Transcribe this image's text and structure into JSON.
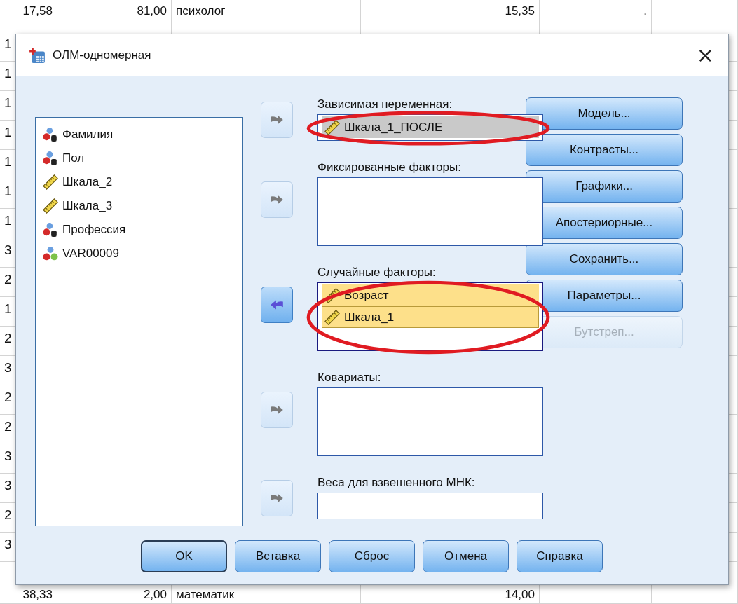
{
  "sheet": {
    "rows": [
      {
        "kind": "full",
        "cells": [
          "17,58",
          "81,00",
          "психолог",
          "15,35",
          "."
        ]
      },
      {
        "kind": "cut",
        "cells": [
          "1"
        ]
      },
      {
        "kind": "cut",
        "cells": [
          "1"
        ]
      },
      {
        "kind": "cut",
        "cells": [
          "1"
        ]
      },
      {
        "kind": "cut",
        "cells": [
          "1"
        ]
      },
      {
        "kind": "cut",
        "cells": [
          "1"
        ]
      },
      {
        "kind": "cut",
        "cells": [
          "1"
        ]
      },
      {
        "kind": "cut",
        "cells": [
          "1"
        ]
      },
      {
        "kind": "cut",
        "cells": [
          "3"
        ]
      },
      {
        "kind": "cut",
        "cells": [
          "2"
        ]
      },
      {
        "kind": "cut",
        "cells": [
          "1"
        ]
      },
      {
        "kind": "cut",
        "cells": [
          "2"
        ]
      },
      {
        "kind": "cut",
        "cells": [
          "3"
        ]
      },
      {
        "kind": "cut",
        "cells": [
          "2"
        ]
      },
      {
        "kind": "cut",
        "cells": [
          "2"
        ]
      },
      {
        "kind": "cut",
        "cells": [
          "3"
        ]
      },
      {
        "kind": "cut",
        "cells": [
          "3"
        ]
      },
      {
        "kind": "cut",
        "cells": [
          "2"
        ]
      },
      {
        "kind": "cut",
        "cells": [
          "3"
        ]
      },
      {
        "kind": "last",
        "cells": [
          "38,33",
          "2,00",
          "математик",
          "14,00"
        ]
      }
    ]
  },
  "dialog": {
    "title": "ОЛМ-одномерная",
    "close": "×",
    "variables": [
      {
        "name": "Фамилия",
        "kind": "nominal-string",
        "selected": false
      },
      {
        "name": "Пол",
        "kind": "nominal-string",
        "selected": false
      },
      {
        "name": "Шкала_2",
        "kind": "scale",
        "selected": false
      },
      {
        "name": "Шкала_3",
        "kind": "scale",
        "selected": false
      },
      {
        "name": "Профессия",
        "kind": "nominal-string",
        "selected": false
      },
      {
        "name": "VAR00009",
        "kind": "nominal",
        "selected": false
      }
    ],
    "targets": [
      {
        "label": "Зависимая переменная:",
        "kind": "single",
        "active": false,
        "circled": true,
        "arrow": {
          "kind": "right",
          "highlighted": false
        },
        "items": [
          {
            "name": "Шкала_1_ПОСЛЕ",
            "kind": "scale",
            "selected": true,
            "focused": false
          }
        ]
      },
      {
        "label": "Фиксированные факторы:",
        "kind": "list",
        "active": false,
        "circled": false,
        "arrow": {
          "kind": "right",
          "highlighted": false
        }
      },
      {
        "label": "Случайные факторы:",
        "kind": "list",
        "active": true,
        "circled": true,
        "arrow": {
          "kind": "left",
          "highlighted": true
        },
        "items": [
          {
            "name": "Возраст",
            "kind": "scale",
            "selected": true,
            "focused": false
          },
          {
            "name": "Шкала_1",
            "kind": "scale",
            "selected": true,
            "focused": true
          }
        ]
      },
      {
        "label": "Ковариаты:",
        "kind": "list",
        "active": false,
        "circled": false,
        "arrow": {
          "kind": "right",
          "highlighted": false
        }
      },
      {
        "label": "Веса для взвешенного МНК:",
        "kind": "single",
        "active": false,
        "circled": false,
        "arrow": {
          "kind": "right",
          "highlighted": false
        }
      }
    ],
    "side_buttons": [
      {
        "label": "Модель...",
        "disabled": false
      },
      {
        "label": "Контрасты...",
        "disabled": false
      },
      {
        "label": "Графики...",
        "disabled": false
      },
      {
        "label": "Апостериорные...",
        "disabled": false
      },
      {
        "label": "Сохранить...",
        "disabled": false
      },
      {
        "label": "Параметры...",
        "disabled": false
      },
      {
        "label": "Бутстреп...",
        "disabled": true
      }
    ],
    "buttons": [
      {
        "label": "OK",
        "default": true
      },
      {
        "label": "Вставка",
        "default": false
      },
      {
        "label": "Сброс",
        "default": false
      },
      {
        "label": "Отмена",
        "default": false
      },
      {
        "label": "Справка",
        "default": false
      }
    ]
  }
}
